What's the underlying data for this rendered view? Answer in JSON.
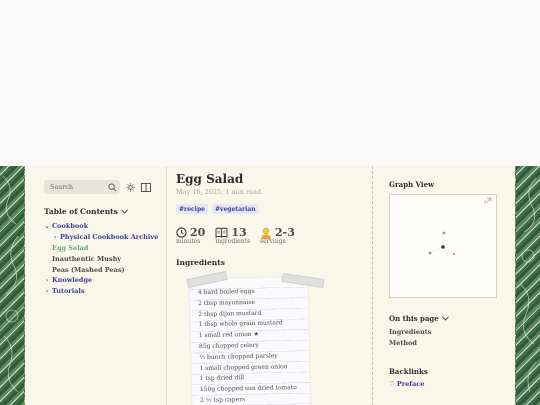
{
  "search": {
    "placeholder": "Search"
  },
  "toc": {
    "title": "Table of Contents",
    "items": [
      {
        "label": "Cookbook"
      },
      {
        "label": "Physical Cookbook Archive"
      },
      {
        "label": "Egg Salad"
      },
      {
        "label": "Inauthentic Mushy Peas (Mashed Peas)"
      },
      {
        "label": "Knowledge"
      },
      {
        "label": "Tutorials"
      }
    ]
  },
  "article": {
    "title": "Egg Salad",
    "meta": "May 16, 2025, 1 min read",
    "tags": [
      "#recipe",
      "#vegetarian"
    ],
    "stats": [
      {
        "value": "20",
        "label": "minutes",
        "icon": "clock-icon"
      },
      {
        "value": "13",
        "label": "ingredients",
        "icon": "book-icon"
      },
      {
        "value": "2-3",
        "label": "servings",
        "icon": "person-icon"
      }
    ],
    "ingredients_heading": "Ingredients",
    "ingredients": [
      "4 hard boiled eggs",
      "2 tbsp mayonnaise",
      "2 tbsp dijon mustard",
      "1 tbsp whole grain mustard",
      "1 small red onion ★",
      "85g chopped celery",
      "½ bunch chopped parsley",
      "1 small chopped green onion",
      "1 tsp dried dill",
      "150g chopped sun dried tomato",
      "2 ½ tsp capers"
    ]
  },
  "right": {
    "graph_title": "Graph View",
    "on_this_page_title": "On this page",
    "on_this_page": [
      "Ingredients",
      "Method"
    ],
    "backlinks_title": "Backlinks",
    "backlinks": [
      "Preface"
    ]
  },
  "colors": {
    "accent": "#3b3c9c",
    "active": "#6da47c",
    "page_bg": "#f9f6ea"
  }
}
